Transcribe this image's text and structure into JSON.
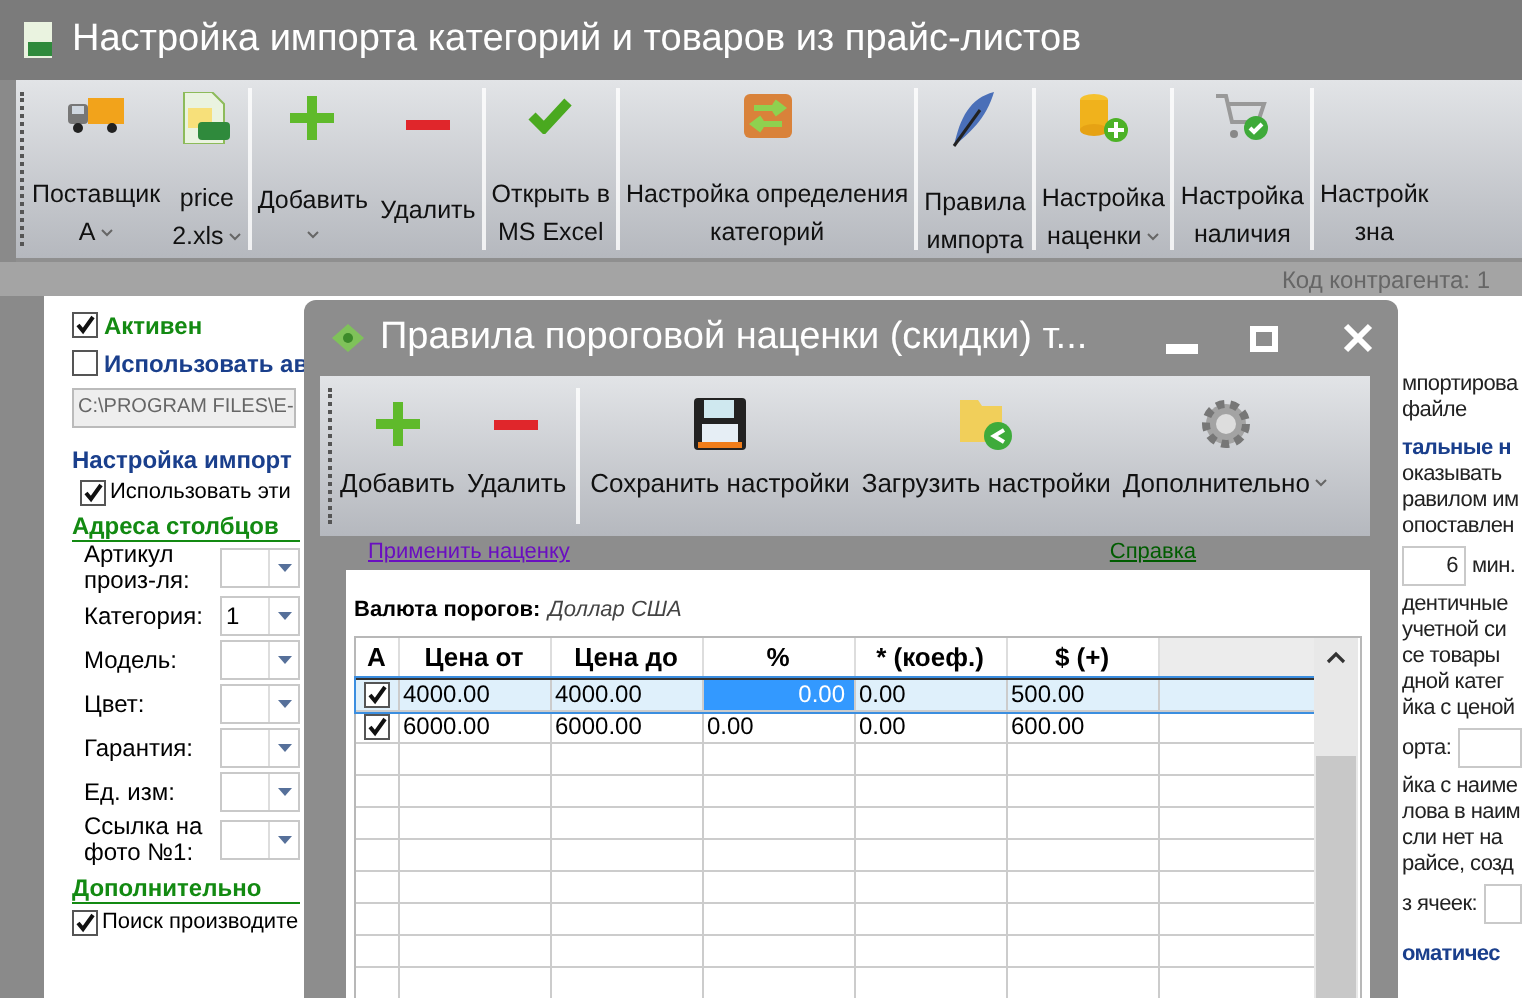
{
  "window": {
    "title": "Настройка импорта категорий и товаров из прайс-листов"
  },
  "toolbar": [
    {
      "lines": [
        "Поставщик",
        "А"
      ],
      "dropdown": true
    },
    {
      "lines": [
        "price",
        "2.xls"
      ],
      "dropdown": true
    },
    {
      "lines": [
        "Добавить"
      ],
      "dropdown": true
    },
    {
      "lines": [
        "Удалить"
      ],
      "dropdown": false
    },
    {
      "lines": [
        "Открыть в",
        "MS Excel"
      ],
      "dropdown": false
    },
    {
      "lines": [
        "Настройка определения",
        "категорий"
      ],
      "dropdown": false
    },
    {
      "lines": [
        "Правила",
        "импорта"
      ],
      "dropdown": false
    },
    {
      "lines": [
        "Настройка",
        "наценки"
      ],
      "dropdown": true
    },
    {
      "lines": [
        "Настройка",
        "наличия"
      ],
      "dropdown": false
    },
    {
      "lines": [
        "Настройк",
        "зна"
      ],
      "dropdown": false
    }
  ],
  "status_bar": {
    "text": "Код контрагента: 1"
  },
  "left_panel": {
    "checks": [
      {
        "label": "Активен",
        "checked": true,
        "kind": "active"
      },
      {
        "label": "Использовать ав",
        "checked": false,
        "kind": "section"
      }
    ],
    "path": "C:\\PROGRAM FILES\\E-",
    "import_group": "Настройка импорт",
    "use_these": {
      "label": "Использовать эти",
      "checked": true
    },
    "columns_heading": "Адреса столбцов",
    "column_fields": [
      {
        "label": "Артикул произ-ля:"
      },
      {
        "label": "Категория:",
        "value": "1"
      },
      {
        "label": "Модель:"
      },
      {
        "label": "Цвет:"
      },
      {
        "label": "Гарантия:"
      },
      {
        "label": "Ед. изм:"
      },
      {
        "label": "Ссылка на фото №1:"
      }
    ],
    "extra_heading": "Дополнительно",
    "extra_checks": [
      {
        "label": "Поиск производите",
        "checked": true
      }
    ]
  },
  "right_panel": [
    {
      "kind": "text",
      "text": "мпортирова"
    },
    {
      "kind": "text",
      "text": "файле"
    },
    {
      "kind": "heading",
      "text": "тальные н"
    },
    {
      "kind": "text",
      "text": "оказывать"
    },
    {
      "kind": "text",
      "text": "равилом им"
    },
    {
      "kind": "text",
      "text": "опоставлен"
    },
    {
      "kind": "field",
      "value": "6",
      "suffix": "мин."
    },
    {
      "kind": "text",
      "text": "дентичные"
    },
    {
      "kind": "text",
      "text": "учетной си"
    },
    {
      "kind": "text",
      "text": "се товары"
    },
    {
      "kind": "text",
      "text": "дной катег"
    },
    {
      "kind": "text",
      "text": "йка с ценой"
    },
    {
      "kind": "field",
      "prefix": "орта:"
    },
    {
      "kind": "text",
      "text": "йка с наиме"
    },
    {
      "kind": "text",
      "text": "лова в наим"
    },
    {
      "kind": "text",
      "text": "сли нет на"
    },
    {
      "kind": "text",
      "text": "райсе, созд"
    },
    {
      "kind": "field",
      "prefix": "з ячеек:"
    },
    {
      "kind": "heading",
      "text": "оматичес"
    }
  ],
  "dialog": {
    "title": "Правила пороговой наценки (скидки) т...",
    "toolbar": [
      {
        "label": "Добавить",
        "dropdown": false
      },
      {
        "label": "Удалить",
        "dropdown": false
      },
      {
        "label": "Сохранить настройки",
        "dropdown": false
      },
      {
        "label": "Загрузить настройки",
        "dropdown": false
      },
      {
        "label": "Дополнительно",
        "dropdown": true
      }
    ],
    "links": [
      {
        "text": "Применить наценку",
        "visited": true
      },
      {
        "text": "Справка",
        "visited": false
      }
    ],
    "currency_label": "Валюта порогов:",
    "currency": "Доллар США",
    "columns": [
      "А",
      "Цена от",
      "Цена до",
      "%",
      "* (коеф.)",
      "$ (+)"
    ],
    "rows": [
      {
        "selected": true,
        "cells": [
          {
            "kind": "checkbox",
            "checked": true
          },
          {
            "kind": "text",
            "text": "4000.00",
            "focused": false
          },
          {
            "kind": "text",
            "text": "4000.00",
            "focused": false
          },
          {
            "kind": "text",
            "text": "0.00",
            "focused": true
          },
          {
            "kind": "text",
            "text": "0.00",
            "focused": false
          },
          {
            "kind": "text",
            "text": "500.00",
            "focused": false
          }
        ]
      },
      {
        "selected": false,
        "cells": [
          {
            "kind": "checkbox",
            "checked": true
          },
          {
            "kind": "text",
            "text": "6000.00",
            "focused": false
          },
          {
            "kind": "text",
            "text": "6000.00",
            "focused": false
          },
          {
            "kind": "text",
            "text": "0.00",
            "focused": false
          },
          {
            "kind": "text",
            "text": "0.00",
            "focused": false
          },
          {
            "kind": "text",
            "text": "600.00",
            "focused": false
          }
        ]
      }
    ]
  }
}
